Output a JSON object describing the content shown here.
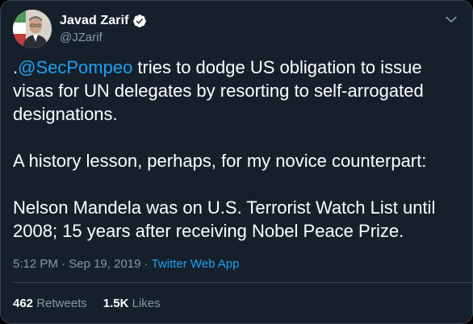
{
  "author": {
    "display_name": "Javad Zarif",
    "handle": "@JZarif",
    "avatar_icon": "profile-photo",
    "verified_icon": "verified-badge-icon",
    "menu_icon": "chevron-down-icon"
  },
  "tweet": {
    "line1_prefix": ".",
    "mention": "@SecPompeo",
    "line1_rest": " tries to dodge US obligation to issue visas for UN delegates by resorting to self-arrogated designations.",
    "paragraph2": "A history lesson, perhaps, for my novice counterpart:",
    "paragraph3": "Nelson Mandela was on U.S. Terrorist Watch List until 2008; 15 years after receiving Nobel Peace Prize."
  },
  "meta": {
    "time": "5:12 PM",
    "separator1": " · ",
    "date": "Sep 19, 2019",
    "separator2": " · ",
    "source": "Twitter Web App"
  },
  "stats": {
    "retweets_count": "462",
    "retweets_label": "Retweets",
    "likes_count": "1.5K",
    "likes_label": "Likes"
  },
  "colors": {
    "background": "#15202b",
    "text": "#ffffff",
    "secondary": "#8899a6",
    "accent": "#1da1f2",
    "border": "#38444d"
  }
}
